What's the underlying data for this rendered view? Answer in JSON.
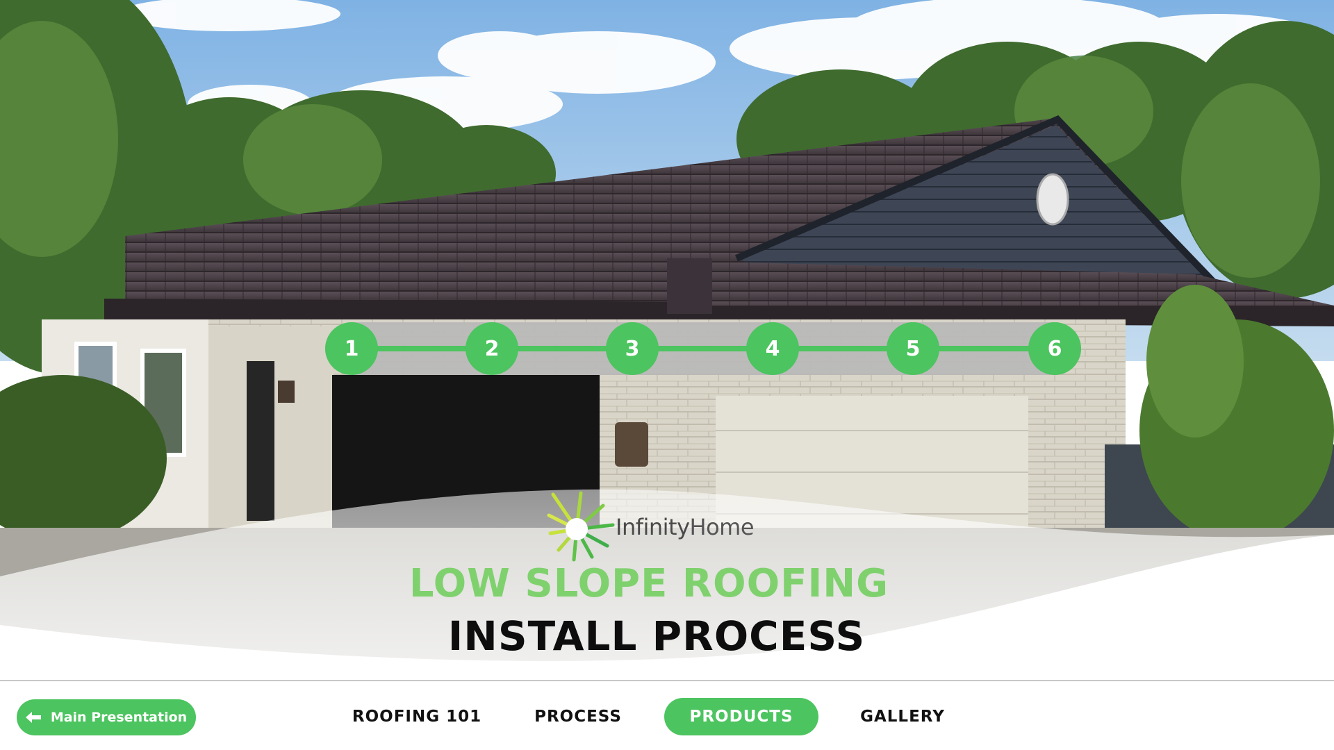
{
  "steps": {
    "items": [
      "1",
      "2",
      "3",
      "4",
      "5",
      "6"
    ]
  },
  "logo": {
    "text_1": "Infinity",
    "text_2": "Home"
  },
  "title": {
    "line_1": "LOW SLOPE ROOFING",
    "line_2": "INSTALL PROCESS"
  },
  "nav": {
    "main_button": "Main Presentation",
    "items": [
      {
        "label": "ROOFING 101"
      },
      {
        "label": "PROCESS"
      },
      {
        "label": "PRODUCTS"
      },
      {
        "label": "GALLERY"
      }
    ],
    "active_index": 2
  },
  "colors": {
    "accent": "#4cc45f",
    "title_green": "#7fd16d",
    "title_dark": "#0d0d0d"
  }
}
